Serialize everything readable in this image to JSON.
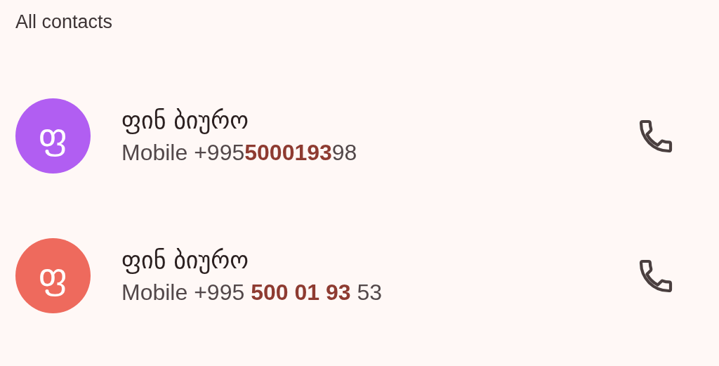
{
  "header": "All contacts",
  "contacts": [
    {
      "initial": "ფ",
      "color": "#b15ef2",
      "name": "ფინ ბიურო",
      "phone": "Mobile +995**5000193**98"
    },
    {
      "initial": "ფ",
      "color": "#ee6a5d",
      "name": "ფინ ბიურო",
      "phone": "Mobile +995 **500 01 93** 53"
    }
  ]
}
